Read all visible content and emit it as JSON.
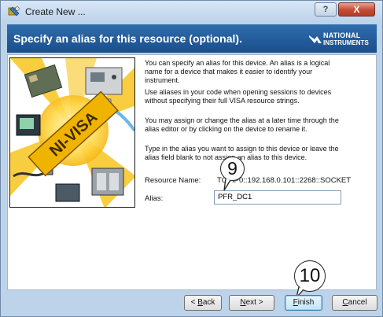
{
  "window": {
    "title": "Create New ...",
    "help_label": "?",
    "close_label": "X"
  },
  "header": {
    "title": "Specify an alias for this resource (optional).",
    "logo_line1": "NATIONAL",
    "logo_line2": "INSTRUMENTS"
  },
  "artwork": {
    "banner_text": "NI-VISA"
  },
  "instructions": [
    "You can specify an alias for this device. An alias is a logical name for a device that makes it easier to identify your instrument.",
    "Use aliases in your code when opening sessions to devices without specifying their full VISA resource strings.",
    "You may assign or change the alias at a later time through the alias editor or by clicking on the device to rename it.",
    "Type in the alias you want to assign to this device or leave the alias field blank to not assign an alias to this device."
  ],
  "resource": {
    "label": "Resource Name:",
    "value": "TCPIP0::192.168.0.101::2268::SOCKET"
  },
  "alias": {
    "label": "Alias:",
    "value": "PFR_DC1"
  },
  "callouts": {
    "step_alias": "9",
    "step_finish": "10"
  },
  "buttons": {
    "back_prefix": "< ",
    "back_key": "B",
    "back_rest": "ack",
    "next_key": "N",
    "next_rest": "ext >",
    "finish_key": "F",
    "finish_rest": "inish",
    "cancel_key": "C",
    "cancel_rest": "ancel"
  }
}
